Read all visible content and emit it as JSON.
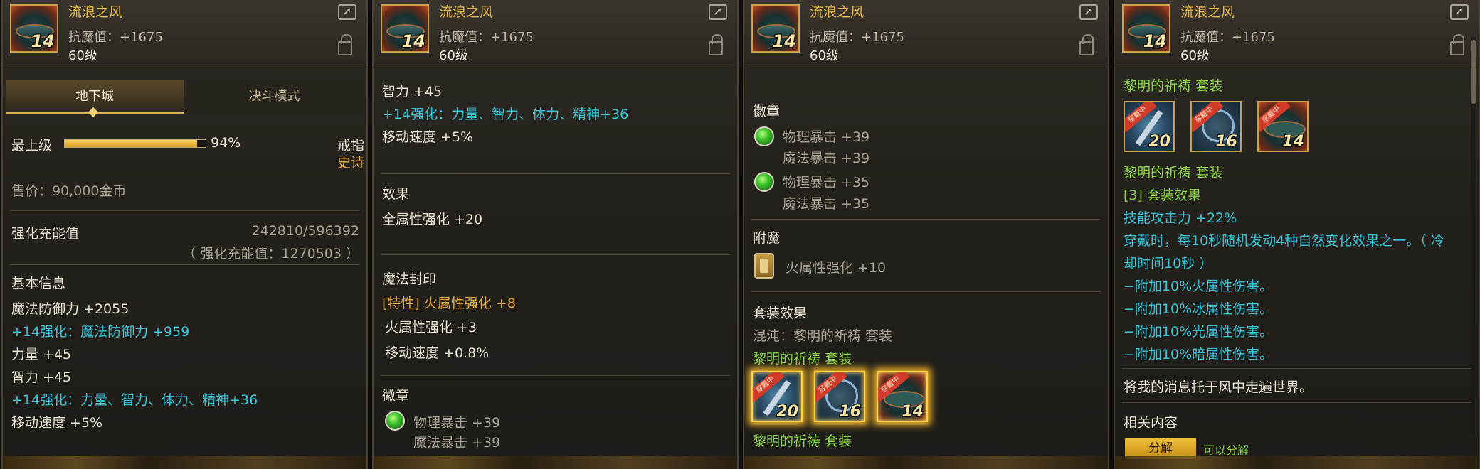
{
  "item": {
    "name": "流浪之风",
    "stat": "抗魔值：+1675",
    "level": "60级",
    "icon_level": "14"
  },
  "panel1": {
    "tabs": [
      "地下城",
      "决斗模式"
    ],
    "grade_label": "最上级",
    "grade_percent": "94%",
    "grade_fraction": 0.94,
    "type": "戒指",
    "rarity": "史诗",
    "price": "售价：90,000金币",
    "charge_label": "强化充能值",
    "charge_value": "242810/596392",
    "charge_sub": "（ 强化充能值：1270503 ）",
    "basic_title": "基本信息",
    "lines": [
      "魔法防御力 +2055",
      "+14强化：魔法防御力 +959",
      "力量 +45",
      "智力 +45",
      "+14强化：力量、智力、体力、精神+36",
      "移动速度 +5%"
    ]
  },
  "panel2": {
    "line1": "智力 +45",
    "line2": "+14强化：力量、智力、体力、精神+36",
    "line3": "移动速度 +5%",
    "effect_title": "效果",
    "effect_line": "全属性强化 +20",
    "seal_title": "魔法封印",
    "seal_lines": [
      "[特性] 火属性强化 +8",
      "火属性强化 +3",
      "移动速度 +0.8%"
    ],
    "emblem_title": "徽章",
    "emblem": [
      "物理暴击 +39",
      "魔法暴击 +39"
    ]
  },
  "panel3": {
    "emblem_title": "徽章",
    "emblems": [
      [
        "物理暴击 +39",
        "魔法暴击 +39"
      ],
      [
        "物理暴击 +35",
        "魔法暴击 +35"
      ]
    ],
    "enchant_title": "附魔",
    "enchant_line": "火属性强化 +10",
    "set_title": "套装效果",
    "chaos_line": "混沌：黎明的祈祷 套装",
    "set_name": "黎明的祈祷",
    "set_tag": "套装",
    "set_levels": [
      "20",
      "16",
      "14"
    ],
    "worn_label": "穿戴中"
  },
  "panel4": {
    "set_name": "黎明的祈祷",
    "set_tag": "套装",
    "set_levels": [
      "20",
      "16",
      "14"
    ],
    "worn_label": "穿戴中",
    "set_effect_title": "[3] 套装效果",
    "effect_lines": [
      "技能攻击力 +22%",
      "穿戴时，每10秒随机发动4种自然变化效果之一。（ 冷",
      "却时间10秒 ）",
      "−附加10%火属性伤害。",
      "−附加10%冰属性伤害。",
      "−附加10%光属性伤害。",
      "−附加10%暗属性伤害。"
    ],
    "flavor": "将我的消息托于风中走遍世界。",
    "related_title": "相关内容",
    "decompose_button": "分解",
    "decompose_status": "可以分解"
  },
  "colors": {
    "gold": "#e4a93a",
    "cyan": "#38c6dc",
    "green": "#8cd44a",
    "white": "#e8e2d4"
  }
}
